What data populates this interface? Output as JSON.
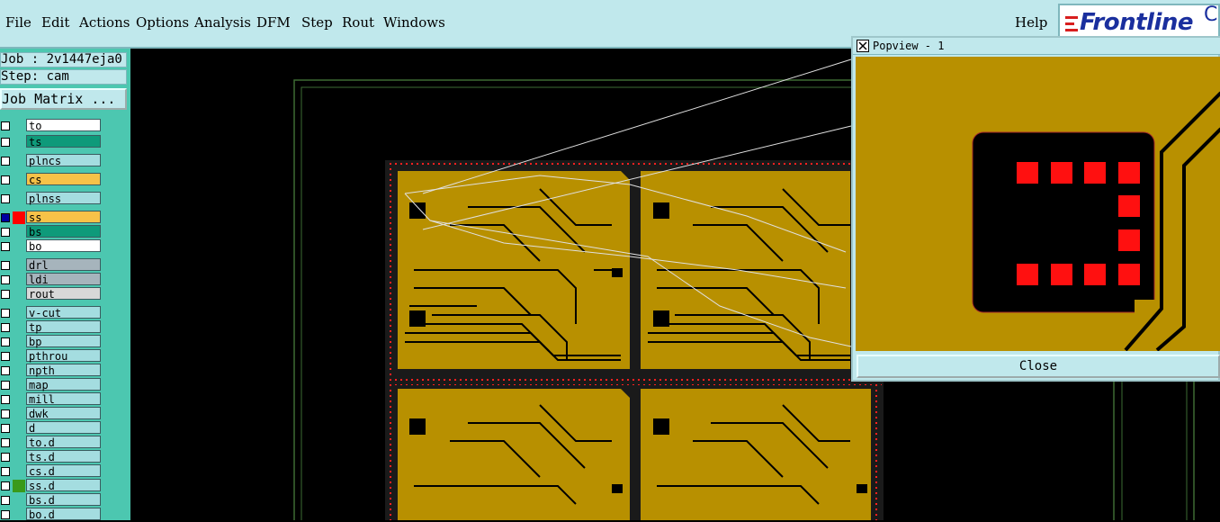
{
  "menu": {
    "items": [
      "File",
      "Edit",
      "Actions",
      "Options",
      "Analysis",
      "DFM",
      "Step",
      "Rout",
      "Windows"
    ],
    "help": "Help"
  },
  "logo": {
    "text": "Frontline",
    "extra": "C"
  },
  "job": {
    "job_line": "Job : 2v1447eja0",
    "step_line": "Step: cam",
    "matrix_button": "Job Matrix ..."
  },
  "layers": [
    {
      "name": "to",
      "color": "#ffffff",
      "swatch": "",
      "row_marker": ""
    },
    {
      "name": "ts",
      "color": "#0e9a7a",
      "swatch": "",
      "row_marker": ""
    },
    {
      "name": "plncs",
      "color": "#a4dde0",
      "swatch": "",
      "row_marker": ""
    },
    {
      "name": "cs",
      "color": "#f7c248",
      "swatch": "",
      "row_marker": ""
    },
    {
      "name": "plnss",
      "color": "#a4dde0",
      "swatch": "",
      "row_marker": ""
    },
    {
      "name": "ss",
      "color": "#f7c248",
      "swatch": "#ff0000",
      "row_marker": "selected"
    },
    {
      "name": "bs",
      "color": "#0e9a7a",
      "swatch": "",
      "row_marker": ""
    },
    {
      "name": "bo",
      "color": "#ffffff",
      "swatch": "",
      "row_marker": ""
    },
    {
      "name": "drl",
      "color": "#a6b4bc",
      "swatch": "",
      "row_marker": ""
    },
    {
      "name": "ldi",
      "color": "#a6b4bc",
      "swatch": "",
      "row_marker": ""
    },
    {
      "name": "rout",
      "color": "#d8d8d8",
      "swatch": "",
      "row_marker": ""
    },
    {
      "name": "v-cut",
      "color": "#a4dde0",
      "swatch": "",
      "row_marker": ""
    },
    {
      "name": "tp",
      "color": "#a4dde0",
      "swatch": "",
      "row_marker": ""
    },
    {
      "name": "bp",
      "color": "#a4dde0",
      "swatch": "",
      "row_marker": ""
    },
    {
      "name": "pthrou",
      "color": "#a4dde0",
      "swatch": "",
      "row_marker": ""
    },
    {
      "name": "npth",
      "color": "#a4dde0",
      "swatch": "",
      "row_marker": ""
    },
    {
      "name": "map",
      "color": "#a4dde0",
      "swatch": "",
      "row_marker": ""
    },
    {
      "name": "mill",
      "color": "#a4dde0",
      "swatch": "",
      "row_marker": ""
    },
    {
      "name": "dwk",
      "color": "#a4dde0",
      "swatch": "",
      "row_marker": ""
    },
    {
      "name": "d",
      "color": "#a4dde0",
      "swatch": "",
      "row_marker": ""
    },
    {
      "name": "to.d",
      "color": "#a4dde0",
      "swatch": "",
      "row_marker": ""
    },
    {
      "name": "ts.d",
      "color": "#a4dde0",
      "swatch": "",
      "row_marker": ""
    },
    {
      "name": "cs.d",
      "color": "#a4dde0",
      "swatch": "",
      "row_marker": ""
    },
    {
      "name": "ss.d",
      "color": "#a4dde0",
      "swatch": "#3a9a1a",
      "row_marker": ""
    },
    {
      "name": "bs.d",
      "color": "#a4dde0",
      "swatch": "",
      "row_marker": ""
    },
    {
      "name": "bo.d",
      "color": "#a4dde0",
      "swatch": "",
      "row_marker": ""
    }
  ],
  "popview": {
    "title": "Popview - 1",
    "close_label": "Close"
  },
  "colors": {
    "copper": "#b89000",
    "pad": "#ff1010",
    "background": "#000000"
  }
}
